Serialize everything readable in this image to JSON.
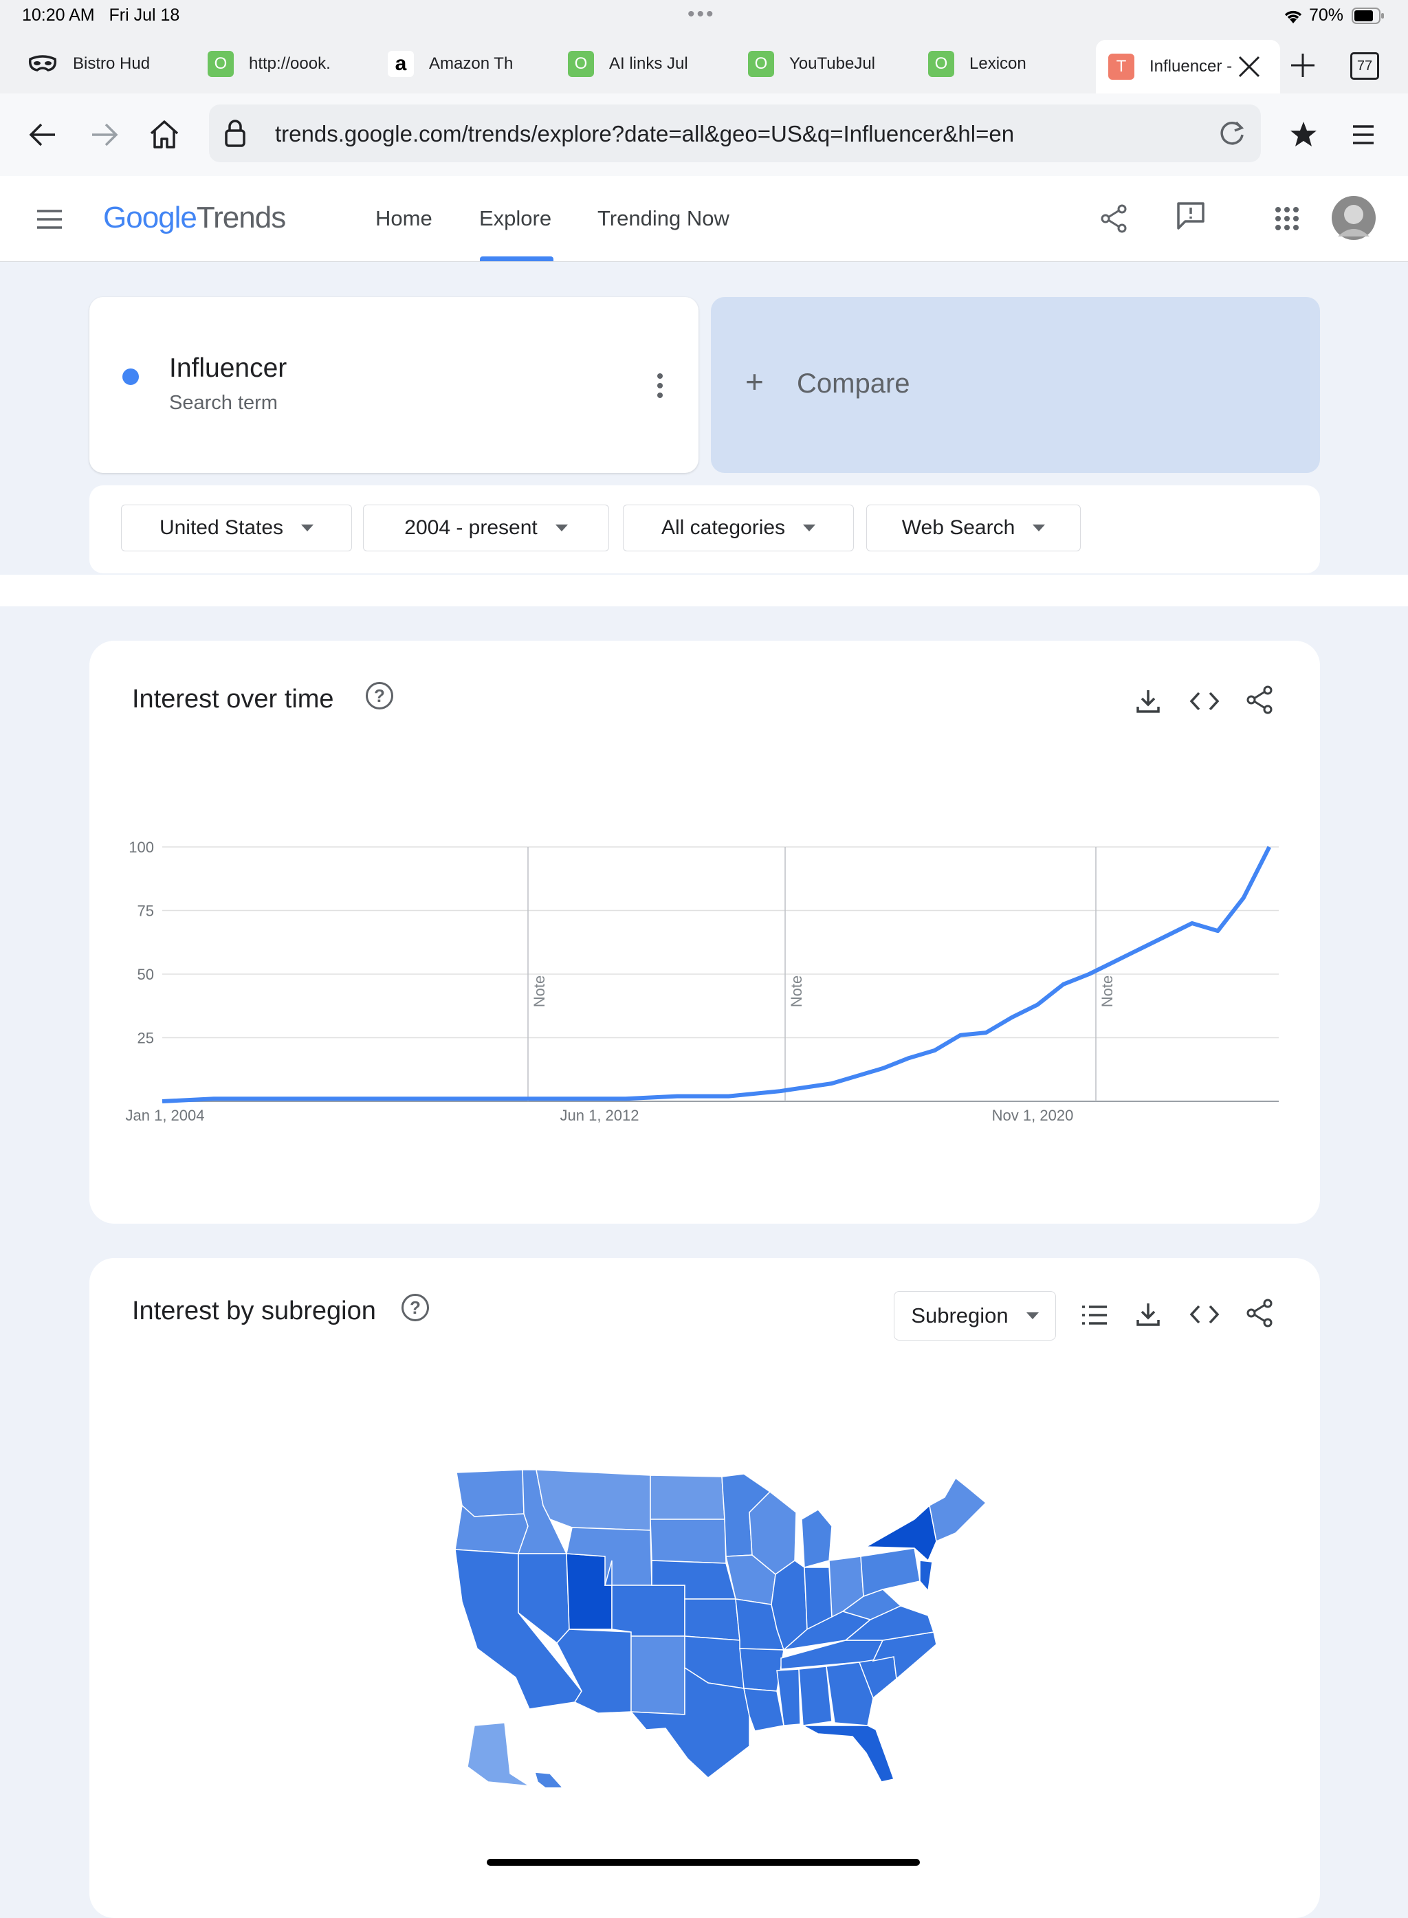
{
  "status_bar": {
    "time": "10:20 AM",
    "date": "Fri Jul 18",
    "battery": "70%",
    "more_dots": "•••"
  },
  "browser": {
    "tabs": [
      {
        "title": "Bistro Hud",
        "favicon": "mask-icon",
        "favicon_text": ""
      },
      {
        "title": "http://oook.",
        "favicon": "green-o",
        "favicon_text": "O"
      },
      {
        "title": "Amazon Th",
        "favicon": "amazon-icon",
        "favicon_text": "a"
      },
      {
        "title": "AI links Jul",
        "favicon": "green-o",
        "favicon_text": "O"
      },
      {
        "title": "YouTubeJul",
        "favicon": "green-o",
        "favicon_text": "O"
      },
      {
        "title": "Lexicon",
        "favicon": "green-o",
        "favicon_text": "O"
      },
      {
        "title": "Influencer -",
        "favicon": "trends-t",
        "favicon_text": "T",
        "active": true
      }
    ],
    "tab_count": "77",
    "url": "trends.google.com/trends/explore?date=all&geo=US&q=Influencer&hl=en"
  },
  "trends_header": {
    "logo_google": "Google",
    "logo_trends": "Trends",
    "nav": [
      "Home",
      "Explore",
      "Trending Now"
    ],
    "active_nav": "Explore"
  },
  "search_term": {
    "term": "Influencer",
    "subtitle": "Search term",
    "color": "#4285f4"
  },
  "compare": {
    "label": "Compare",
    "plus": "+"
  },
  "filters": {
    "region": "United States",
    "time": "2004 - present",
    "category": "All categories",
    "search_type": "Web Search"
  },
  "interest_over_time": {
    "title": "Interest over time",
    "help": "?",
    "chart_data": {
      "type": "line",
      "series": [
        {
          "name": "Influencer",
          "color": "#4285f4",
          "x": [
            "2004",
            "2005",
            "2006",
            "2007",
            "2008",
            "2009",
            "2010",
            "2011",
            "2012",
            "2013",
            "2014",
            "2015",
            "2016",
            "2017",
            "2017.5",
            "2018",
            "2018.5",
            "2019",
            "2019.5",
            "2020",
            "2020.5",
            "2021",
            "2021.5",
            "2022",
            "2022.5",
            "2023",
            "2023.5",
            "2024",
            "2024.5",
            "2025",
            "2025.5"
          ],
          "values": [
            0,
            1,
            1,
            1,
            1,
            1,
            1,
            1,
            1,
            1,
            2,
            2,
            4,
            7,
            10,
            13,
            17,
            20,
            26,
            27,
            33,
            38,
            46,
            50,
            55,
            60,
            65,
            70,
            67,
            80,
            100
          ]
        }
      ],
      "y_ticks": [
        100,
        75,
        50,
        25
      ],
      "x_tick_labels": [
        "Jan 1, 2004",
        "Jun 1, 2012",
        "Nov 1, 2020"
      ],
      "notes": [
        "Note",
        "Note",
        "Note"
      ],
      "ylim": [
        0,
        100
      ]
    }
  },
  "interest_by_subregion": {
    "title": "Interest by subregion",
    "help": "?",
    "dropdown": "Subregion"
  }
}
